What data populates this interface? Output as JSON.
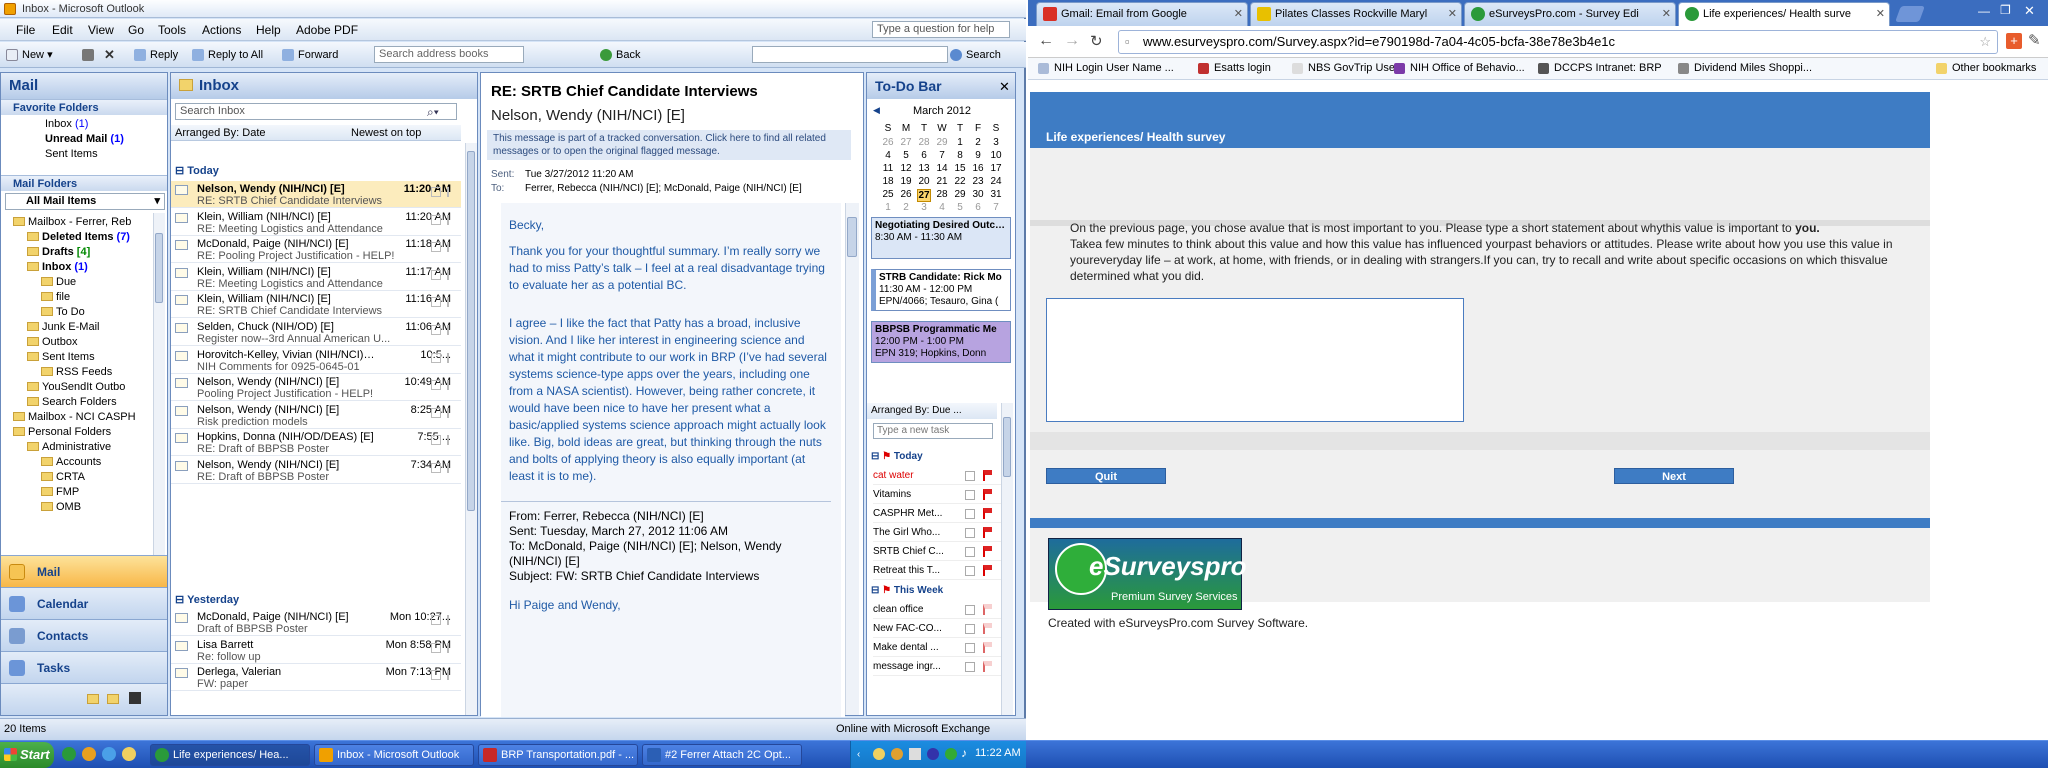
{
  "outlook": {
    "window_title": "Inbox - Microsoft Outlook",
    "menu": [
      "File",
      "Edit",
      "View",
      "Go",
      "Tools",
      "Actions",
      "Help",
      "Adobe PDF"
    ],
    "help_placeholder": "Type a question for help",
    "toolbar": {
      "new": "New",
      "reply": "Reply",
      "reply_all": "Reply to All",
      "forward": "Forward",
      "address_search": "Search address books",
      "back": "Back",
      "search": "Search"
    },
    "nav": {
      "title": "Mail",
      "favorites_header": "Favorite Folders",
      "favorites": [
        {
          "label": "Inbox",
          "count": "(1)"
        },
        {
          "label": "Unread Mail",
          "count": "(1)"
        },
        {
          "label": "Sent Items",
          "count": ""
        }
      ],
      "mail_folders_header": "Mail Folders",
      "all_items": "All Mail Items",
      "tree": [
        {
          "label": "Mailbox - Ferrer, Reb",
          "count": ""
        },
        {
          "label": "Deleted Items",
          "count": "(7)"
        },
        {
          "label": "Drafts",
          "count": "[4]"
        },
        {
          "label": "Inbox",
          "count": "(1)"
        },
        {
          "label": "Due",
          "count": ""
        },
        {
          "label": "file",
          "count": ""
        },
        {
          "label": "To Do",
          "count": ""
        },
        {
          "label": "Junk E-Mail",
          "count": ""
        },
        {
          "label": "Outbox",
          "count": ""
        },
        {
          "label": "Sent Items",
          "count": ""
        },
        {
          "label": "RSS Feeds",
          "count": ""
        },
        {
          "label": "YouSendIt Outbo",
          "count": ""
        },
        {
          "label": "Search Folders",
          "count": ""
        },
        {
          "label": "Mailbox - NCI CASPH",
          "count": ""
        },
        {
          "label": "Personal Folders",
          "count": ""
        },
        {
          "label": "Administrative",
          "count": ""
        },
        {
          "label": "Accounts",
          "count": ""
        },
        {
          "label": "CRTA",
          "count": ""
        },
        {
          "label": "FMP",
          "count": ""
        },
        {
          "label": "OMB",
          "count": ""
        }
      ],
      "buttons": [
        "Mail",
        "Calendar",
        "Contacts",
        "Tasks"
      ]
    },
    "inbox": {
      "title": "Inbox",
      "search_placeholder": "Search Inbox",
      "arranged_by": "Arranged By: Date",
      "sort": "Newest on top",
      "today_label": "Today",
      "yesterday_label": "Yesterday",
      "today": [
        {
          "from": "Nelson, Wendy (NIH/NCI) [E]",
          "time": "11:20 AM",
          "subject": "RE: SRTB Chief Candidate Interviews"
        },
        {
          "from": "Klein, William (NIH/NCI) [E]",
          "time": "11:20 AM",
          "subject": "RE: Meeting Logistics and Attendance"
        },
        {
          "from": "McDonald, Paige (NIH/NCI) [E]",
          "time": "11:18 AM",
          "subject": "RE: Pooling Project Justification - HELP!"
        },
        {
          "from": "Klein, William (NIH/NCI) [E]",
          "time": "11:17 AM",
          "subject": "RE: Meeting Logistics and Attendance"
        },
        {
          "from": "Klein, William (NIH/NCI) [E]",
          "time": "11:16 AM",
          "subject": "RE: SRTB Chief Candidate Interviews"
        },
        {
          "from": "Selden, Chuck (NIH/OD) [E]",
          "time": "11:06 AM",
          "subject": "Register now--3rd Annual American U..."
        },
        {
          "from": "Horovitch-Kelley, Vivian (NIH/NCI) [E]",
          "time": "10:5...",
          "subject": "NIH Comments for 0925-0645-01"
        },
        {
          "from": "Nelson, Wendy (NIH/NCI) [E]",
          "time": "10:49 AM",
          "subject": "Pooling Project Justification - HELP!"
        },
        {
          "from": "Nelson, Wendy (NIH/NCI) [E]",
          "time": "8:25 AM",
          "subject": "Risk prediction models"
        },
        {
          "from": "Hopkins, Donna (NIH/OD/DEAS) [E]",
          "time": "7:55 ...",
          "subject": "RE: Draft of BBPSB Poster"
        },
        {
          "from": "Nelson, Wendy (NIH/NCI) [E]",
          "time": "7:34 AM",
          "subject": "RE: Draft of BBPSB Poster"
        }
      ],
      "yesterday": [
        {
          "from": "McDonald, Paige (NIH/NCI) [E]",
          "time": "Mon 10:27...",
          "subject": "Draft of BBPSB Poster"
        },
        {
          "from": "Lisa Barrett",
          "time": "Mon 8:58 PM",
          "subject": "Re: follow up"
        },
        {
          "from": "Derlega, Valerian",
          "time": "Mon 7:13 PM",
          "subject": "FW: paper"
        }
      ]
    },
    "reading": {
      "subject": "RE: SRTB Chief Candidate Interviews",
      "from": "Nelson, Wendy (NIH/NCI) [E]",
      "tracked": "This message is part of a tracked conversation. Click here to find all related messages or to open the original flagged message.",
      "sent_label": "Sent:",
      "sent": "Tue 3/27/2012 11:20 AM",
      "to_label": "To:",
      "to": "Ferrer, Rebecca (NIH/NCI) [E]; McDonald, Paige (NIH/NCI) [E]",
      "greeting": "Becky,",
      "p1": "Thank you for your thoughtful summary. I’m really sorry we had to miss Patty’s talk – I feel at a real disadvantage trying to evaluate her as a potential BC.",
      "p2": "I agree – I like the fact that Patty has a broad, inclusive vision. And I like her interest in engineering science and what it might contribute to our work in BRP (I’ve had several systems science-type apps over the years, including one from a NASA scientist). However, being rather concrete, it would have been nice to have her present what a basic/applied systems science approach might actually look like. Big, bold ideas are great, but thinking through the nuts and bolts of applying theory is also equally important (at least it is to me).",
      "fw_from": "From: Ferrer, Rebecca (NIH/NCI) [E]",
      "fw_sent": "Sent: Tuesday, March 27, 2012 11:06 AM",
      "fw_to": "To: McDonald, Paige (NIH/NCI) [E]; Nelson, Wendy (NIH/NCI) [E]",
      "fw_subject": "Subject: FW: SRTB Chief Candidate Interviews",
      "fw_greeting": "Hi Paige and Wendy,"
    },
    "todo": {
      "title": "To-Do Bar",
      "month": "March 2012",
      "dow": [
        "S",
        "M",
        "T",
        "W",
        "T",
        "F",
        "S"
      ],
      "weeks": [
        [
          "26",
          "27",
          "28",
          "29",
          "1",
          "2",
          "3"
        ],
        [
          "4",
          "5",
          "6",
          "7",
          "8",
          "9",
          "10"
        ],
        [
          "11",
          "12",
          "13",
          "14",
          "15",
          "16",
          "17"
        ],
        [
          "18",
          "19",
          "20",
          "21",
          "22",
          "23",
          "24"
        ],
        [
          "25",
          "26",
          "27",
          "28",
          "29",
          "30",
          "31"
        ],
        [
          "1",
          "2",
          "3",
          "4",
          "5",
          "6",
          "7"
        ]
      ],
      "appointments": [
        {
          "title": "Negotiating Desired Outcomes",
          "time": "8:30 AM - 11:30 AM",
          "loc": ""
        },
        {
          "title": "STRB Candidate: Rick Mo",
          "time": "11:30 AM - 12:00 PM",
          "loc": "EPN/4066; Tesauro, Gina ("
        },
        {
          "title": "BBPSB Programmatic Me",
          "time": "12:00 PM - 1:00 PM",
          "loc": "EPN 319; Hopkins, Donn"
        }
      ],
      "arranged": "Arranged By: Due ...",
      "new_task": "Type a new task",
      "today_label": "Today",
      "this_week_label": "This Week",
      "tasks_today": [
        "cat water",
        "Vitamins",
        "CASPHR Met...",
        "The Girl Who...",
        "SRTB Chief C...",
        "Retreat this T..."
      ],
      "tasks_week": [
        "clean office",
        "New FAC-CO...",
        "Make dental ...",
        "message ingr..."
      ]
    },
    "status": {
      "items": "20 Items",
      "exchange": "Online with Microsoft Exchange"
    }
  },
  "chrome": {
    "tabs": [
      {
        "title": "Gmail: Email from Google",
        "color": "#d93025"
      },
      {
        "title": "Pilates Classes Rockville Maryl",
        "color": "#e8c000"
      },
      {
        "title": "eSurveysPro.com - Survey Edi",
        "color": "#2a9a3a"
      },
      {
        "title": "Life experiences/ Health surve",
        "color": "#2a9a3a"
      }
    ],
    "url": "www.esurveyspro.com/Survey.aspx?id=e790198d-7a04-4c05-bcfa-38e78e3b4e1c",
    "bookmarks": [
      "NIH Login User Name ...",
      "Esatts login",
      "NBS GovTrip Users",
      "NIH Office of Behavio...",
      "DCCPS Intranet: BRP",
      "Dividend Miles Shoppi..."
    ],
    "other_bookmarks": "Other bookmarks",
    "survey": {
      "title": "Life experiences/ Health survey",
      "text_a": "On the previous page, you chose avalue that is most important to you. Please type a short statement about whythis value is important to ",
      "text_you": "you.",
      "text_b": "Takea few minutes to think about this value and how this value has influenced yourpast behaviors or attitudes. Please write about how you use this value in youreveryday life – at work, at home, with friends, or in dealing with strangers.If you can, try to recall and write about specific occasions on which thisvalue determined what you did.",
      "quit": "Quit",
      "next": "Next",
      "logo_main": "eSurveyspro",
      "logo_sub": "Premium Survey Services",
      "created": "Created with eSurveysPro.com Survey Software."
    }
  },
  "taskbar": {
    "start": "Start",
    "buttons": [
      "Life experiences/ Hea...",
      "Inbox - Microsoft Outlook",
      "BRP Transportation.pdf - ...",
      "#2 Ferrer Attach 2C Opt..."
    ],
    "clock": "11:22 AM"
  }
}
